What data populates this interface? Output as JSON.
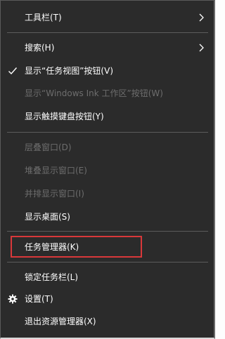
{
  "menu": {
    "items": [
      {
        "label": "工具栏(T)",
        "state": "enabled",
        "submenu": true
      },
      {
        "label": "搜索(H)",
        "state": "enabled",
        "submenu": true
      },
      {
        "label": "显示“任务视图”按钮(V)",
        "state": "enabled",
        "checked": true
      },
      {
        "label": "显示“Windows Ink 工作区”按钮(W)",
        "state": "disabled"
      },
      {
        "label": "显示触摸键盘按钮(Y)",
        "state": "enabled"
      },
      {
        "label": "层叠窗口(D)",
        "state": "disabled"
      },
      {
        "label": "堆叠显示窗口(E)",
        "state": "disabled"
      },
      {
        "label": "并排显示窗口(I)",
        "state": "disabled"
      },
      {
        "label": "显示桌面(S)",
        "state": "enabled"
      },
      {
        "label": "任务管理器(K)",
        "state": "enabled",
        "highlighted": true
      },
      {
        "label": "锁定任务栏(L)",
        "state": "enabled"
      },
      {
        "label": "设置(T)",
        "state": "enabled",
        "icon": "gear-icon"
      },
      {
        "label": "退出资源管理器(X)",
        "state": "enabled"
      }
    ]
  },
  "icons": {
    "submenu": "chevron-right-icon",
    "check": "checkmark-icon",
    "settings": "gear-icon"
  },
  "colors": {
    "menu_background": "#2b2b2b",
    "text": "#ffffff",
    "disabled_text": "#6d6d6d",
    "separator": "#5c5c5c",
    "highlight_border": "#d9383a"
  }
}
